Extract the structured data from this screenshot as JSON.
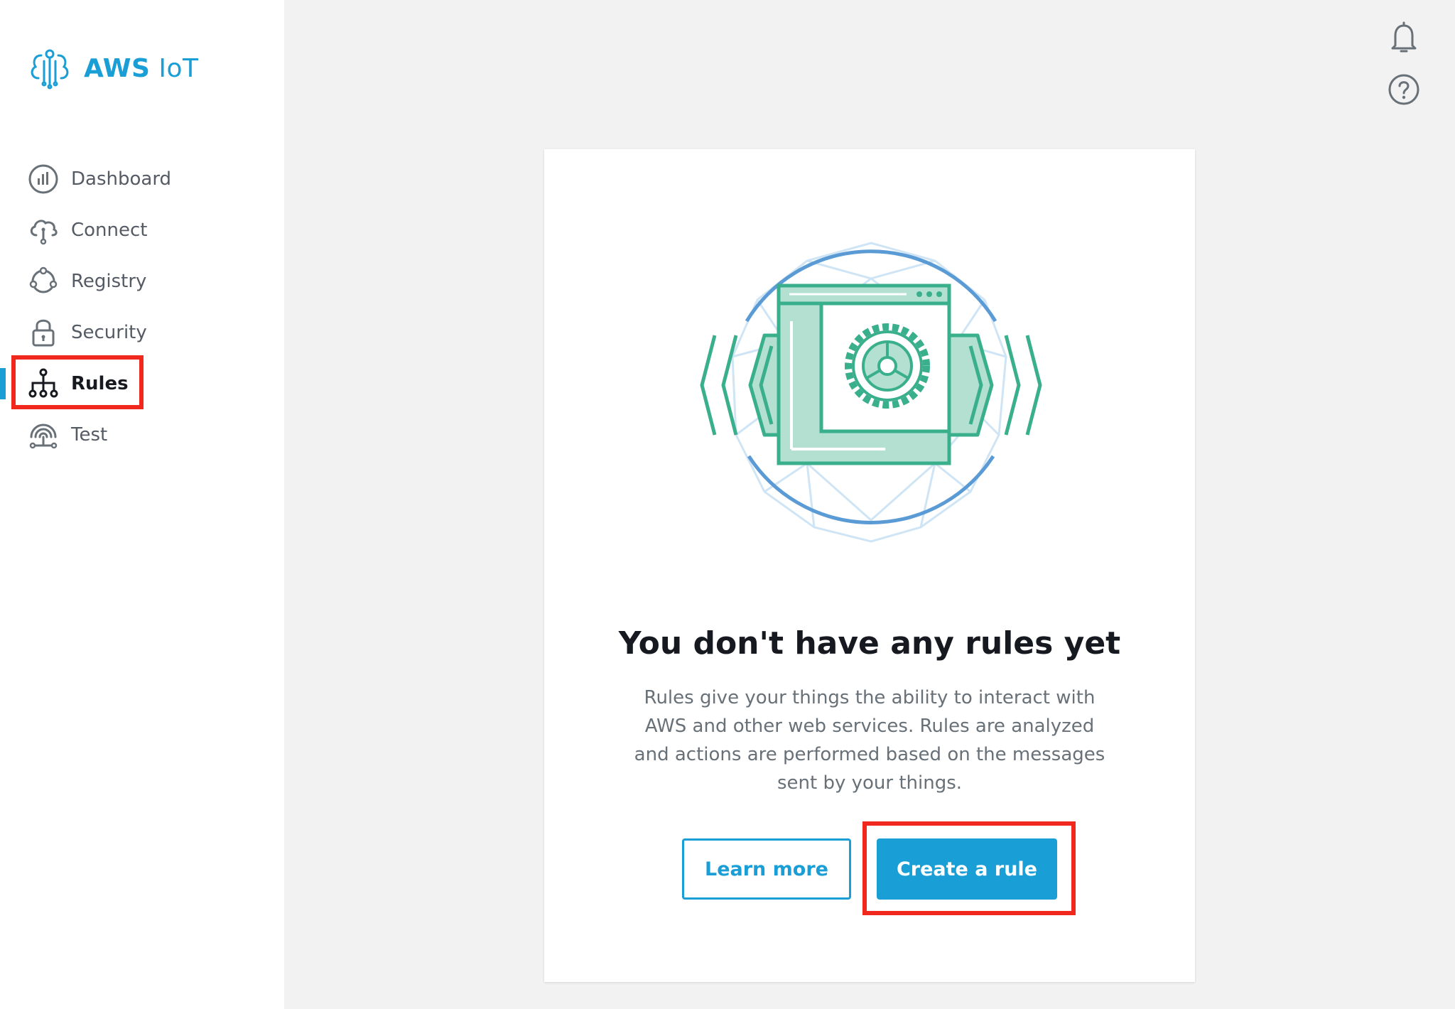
{
  "app": {
    "logo_bold": "AWS",
    "logo_light": " IoT"
  },
  "sidebar": {
    "items": [
      {
        "label": "Dashboard",
        "icon": "dashboard-chart-icon",
        "active": false
      },
      {
        "label": "Connect",
        "icon": "cloud-connect-icon",
        "active": false
      },
      {
        "label": "Registry",
        "icon": "registry-nodes-icon",
        "active": false
      },
      {
        "label": "Security",
        "icon": "lock-icon",
        "active": false
      },
      {
        "label": "Rules",
        "icon": "rules-hierarchy-icon",
        "active": true
      },
      {
        "label": "Test",
        "icon": "test-signal-icon",
        "active": false
      }
    ]
  },
  "header": {
    "icons": [
      "notifications-bell-icon",
      "help-question-icon"
    ]
  },
  "main": {
    "headline": "You don't have any rules yet",
    "description": "Rules give your things the ability to interact with AWS and other web services. Rules are analyzed and actions are performed based on the messages sent by your things.",
    "learn_more_label": "Learn more",
    "create_rule_label": "Create a rule"
  },
  "colors": {
    "accent": "#1a9ed6",
    "highlight": "#f0281e",
    "illustration_green": "#3aaf8c",
    "illustration_green_light": "#b3e0d0",
    "illustration_blue": "#5b9bd5",
    "illustration_blue_light": "#cfe5f5"
  }
}
